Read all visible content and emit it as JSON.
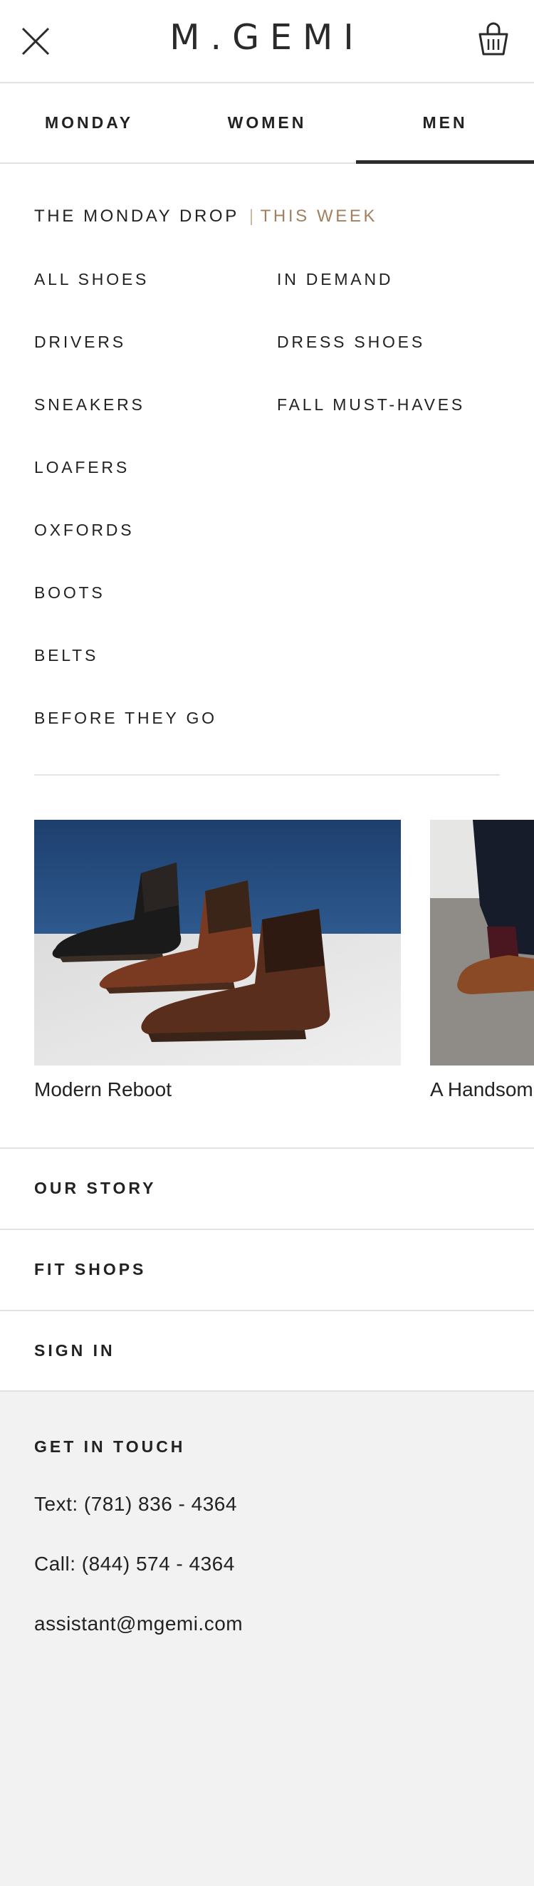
{
  "header": {
    "logo": "M.GEMI",
    "close_icon": "close-icon",
    "bag_icon": "shopping-bag-icon"
  },
  "tabs": [
    {
      "label": "MONDAY",
      "active": false
    },
    {
      "label": "WOMEN",
      "active": false
    },
    {
      "label": "MEN",
      "active": true
    }
  ],
  "drop": {
    "label": "THE MONDAY DROP",
    "separator": "|",
    "week": "THIS WEEK"
  },
  "categories_left": [
    "ALL SHOES",
    "DRIVERS",
    "SNEAKERS",
    "LOAFERS",
    "OXFORDS",
    "BOOTS",
    "BELTS",
    "BEFORE THEY GO"
  ],
  "categories_right": [
    "IN DEMAND",
    "DRESS SHOES",
    "FALL MUST-HAVES"
  ],
  "features": [
    {
      "caption": "Modern Reboot"
    },
    {
      "caption": "A Handsome"
    }
  ],
  "links": [
    "OUR STORY",
    "FIT SHOPS",
    "SIGN IN"
  ],
  "contact": {
    "title": "GET IN TOUCH",
    "text": "Text: (781) 836 - 4364",
    "call": "Call: (844) 574 - 4364",
    "email": "assistant@mgemi.com"
  },
  "colors": {
    "accent": "#a2805f",
    "text": "#222222",
    "footer_bg": "#f2f2f2"
  }
}
